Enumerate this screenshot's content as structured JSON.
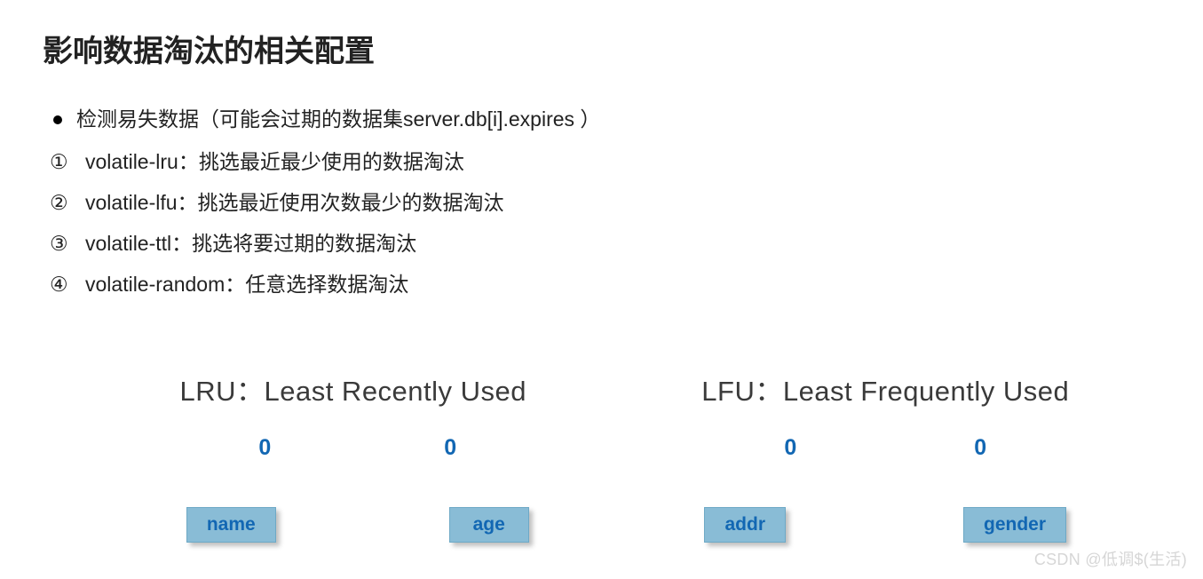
{
  "heading": "影响数据淘汰的相关配置",
  "bullet": "检测易失数据（可能会过期的数据集server.db[i].expires ）",
  "items": [
    {
      "num": "①",
      "text": "volatile-lru：挑选最近最少使用的数据淘汰"
    },
    {
      "num": "②",
      "text": "volatile-lfu：挑选最近使用次数最少的数据淘汰"
    },
    {
      "num": "③",
      "text": "volatile-ttl：挑选将要过期的数据淘汰"
    },
    {
      "num": "④",
      "text": "volatile-random：任意选择数据淘汰"
    }
  ],
  "diagrams": {
    "lru": {
      "title": "LRU：Least Recently Used",
      "values": [
        "0",
        "0"
      ],
      "boxes": [
        "name",
        "age"
      ]
    },
    "lfu": {
      "title": "LFU：Least Frequently Used",
      "values": [
        "0",
        "0"
      ],
      "boxes": [
        "addr",
        "gender"
      ]
    }
  },
  "watermark": "CSDN @低调$(生活)"
}
